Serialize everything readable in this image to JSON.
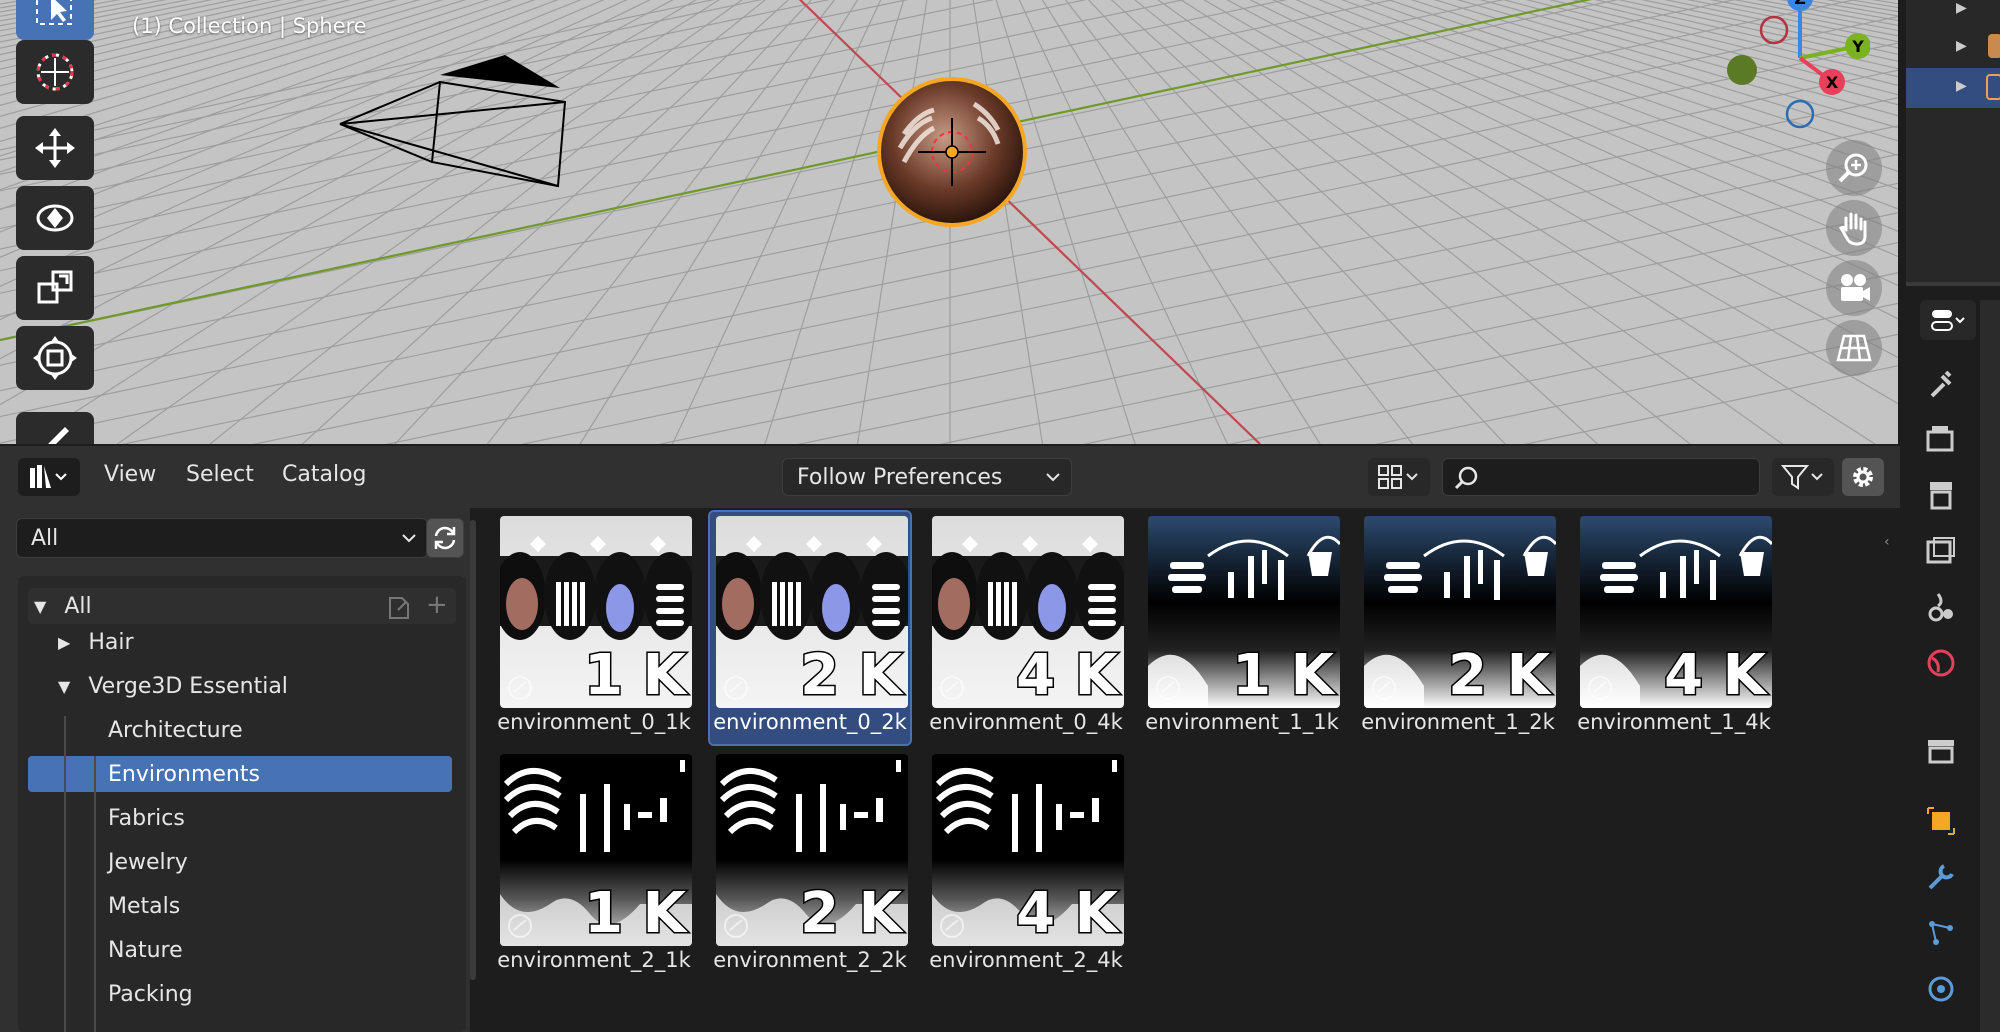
{
  "viewport": {
    "info_text": "(1) Collection | Sphere",
    "gizmo_axes": {
      "z": "Z",
      "y": "Y",
      "x": "X"
    },
    "tools": [
      "select-box-icon",
      "cursor-icon",
      "move-icon",
      "rotate-icon",
      "scale-icon",
      "transform-icon",
      "annotate-icon"
    ],
    "nav": [
      "zoom-icon",
      "pan-hand-icon",
      "camera-view-icon",
      "perspective-grid-icon"
    ]
  },
  "asset_browser": {
    "menu": {
      "view": "View",
      "select": "Select",
      "catalog": "Catalog"
    },
    "import_method": "Follow Preferences",
    "library": "All",
    "search_value": "",
    "catalog_tree": {
      "root": "All",
      "items": [
        {
          "label": "Hair",
          "level": 1,
          "expanded": false
        },
        {
          "label": "Verge3D Essential",
          "level": 1,
          "expanded": true
        },
        {
          "label": "Architecture",
          "level": 2
        },
        {
          "label": "Environments",
          "level": 2,
          "selected": true
        },
        {
          "label": "Fabrics",
          "level": 2
        },
        {
          "label": "Jewelry",
          "level": 2
        },
        {
          "label": "Metals",
          "level": 2
        },
        {
          "label": "Nature",
          "level": 2
        },
        {
          "label": "Packing",
          "level": 2
        }
      ]
    },
    "assets": [
      {
        "name": "environment_0_1k",
        "res": "1K",
        "style": 0,
        "selected": false
      },
      {
        "name": "environment_0_2k",
        "res": "2K",
        "style": 0,
        "selected": true
      },
      {
        "name": "environment_0_4k",
        "res": "4K",
        "style": 0,
        "selected": false
      },
      {
        "name": "environment_1_1k",
        "res": "1K",
        "style": 1,
        "selected": false
      },
      {
        "name": "environment_1_2k",
        "res": "2K",
        "style": 1,
        "selected": false
      },
      {
        "name": "environment_1_4k",
        "res": "4K",
        "style": 1,
        "selected": false
      },
      {
        "name": "environment_2_1k",
        "res": "1K",
        "style": 2,
        "selected": false
      },
      {
        "name": "environment_2_2k",
        "res": "2K",
        "style": 2,
        "selected": false
      },
      {
        "name": "environment_2_4k",
        "res": "4K",
        "style": 2,
        "selected": false
      }
    ]
  },
  "colors": {
    "accent": "#4772b3",
    "selection_orange": "#f5a623",
    "axis_x": "#e8405a",
    "axis_y": "#7ab31f",
    "axis_z": "#3b86e0"
  }
}
